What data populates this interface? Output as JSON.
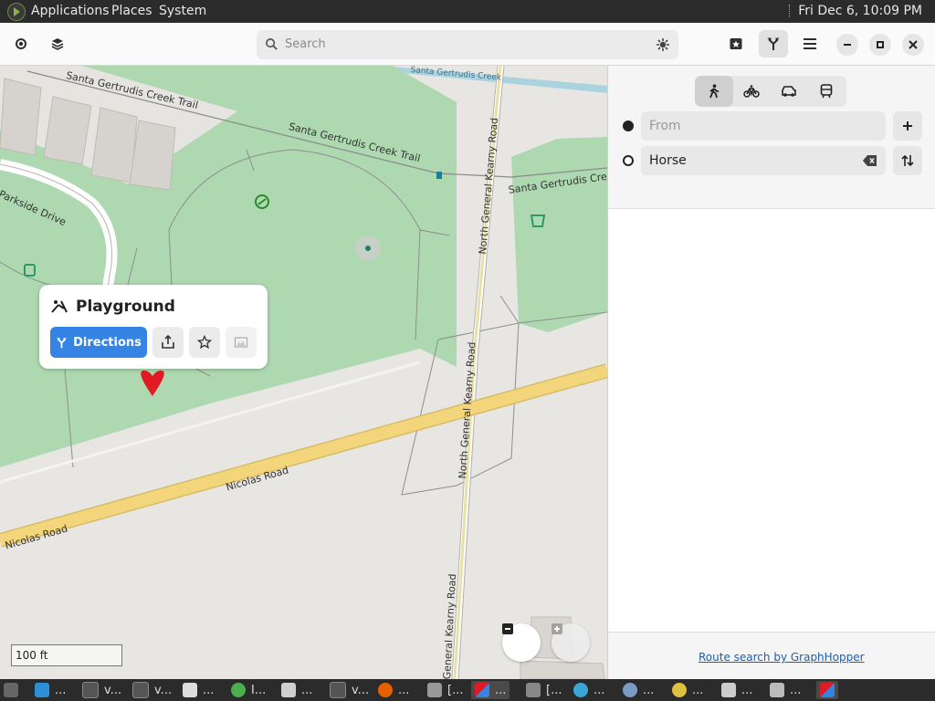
{
  "system_panel": {
    "menus": [
      "Applications",
      "Places",
      "System"
    ],
    "clock": "Fri Dec  6, 10:09 PM"
  },
  "header": {
    "search_placeholder": "Search"
  },
  "map": {
    "labels": {
      "trail_1": "Santa Gertrudis Creek Trail",
      "trail_2": "Santa Gertrudis Creek Trail",
      "trail_3": "Santa Gertrudis Cree",
      "parkside": "Parkside Drive",
      "ngk_1": "North General Kearny Road",
      "ngk_2": "North General Kearny Road",
      "gk": "General Kearny Road",
      "nicolas_1": "Nicolas Road",
      "nicolas_2": "Nicolas Road",
      "top_label": "Santa Gertrudis Creek"
    },
    "scale": "100 ft"
  },
  "popup": {
    "title": "Playground",
    "directions_label": "Directions"
  },
  "sidebar": {
    "from_placeholder": "From",
    "to_value": "Horse",
    "footer_link": "Route search by GraphHopper"
  },
  "taskbar": {
    "items": [
      "...",
      "v...",
      "v...",
      "...",
      "I...",
      "...",
      "v...",
      "...",
      "[...",
      "...",
      "[...",
      "...",
      "...",
      "...",
      "...",
      "...",
      ""
    ]
  },
  "colors": {
    "accent": "#3584e4",
    "marker": "#e01b24",
    "park": "#a9d6ad",
    "road": "#f3d67c"
  }
}
